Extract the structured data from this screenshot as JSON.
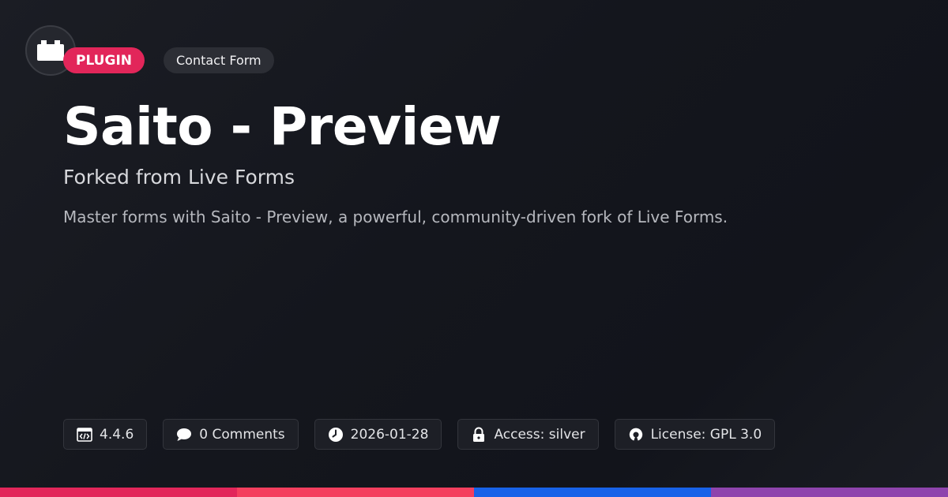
{
  "header": {
    "logo_icon": "extension-block-icon",
    "tags": {
      "type_label": "PLUGIN",
      "category_label": "Contact Form"
    }
  },
  "main": {
    "title": "Saito - Preview",
    "subtitle": "Forked from Live Forms",
    "description": "Master forms with Saito - Preview, a powerful, community-driven fork of Live Forms."
  },
  "meta": {
    "version": {
      "icon": "code-icon",
      "text": "4.4.6"
    },
    "comments": {
      "icon": "comment-icon",
      "text": "0 Comments"
    },
    "date": {
      "icon": "clock-icon",
      "text": "2026-01-28"
    },
    "access": {
      "icon": "lock-icon",
      "text": "Access: silver"
    },
    "license": {
      "icon": "open-source-icon",
      "text": "License: GPL 3.0"
    }
  },
  "colors": {
    "accent_plugin": "#e2265a",
    "bar_segments": [
      "#e2265a",
      "#f43f5e",
      "#1862e8",
      "#8e44ad"
    ]
  }
}
